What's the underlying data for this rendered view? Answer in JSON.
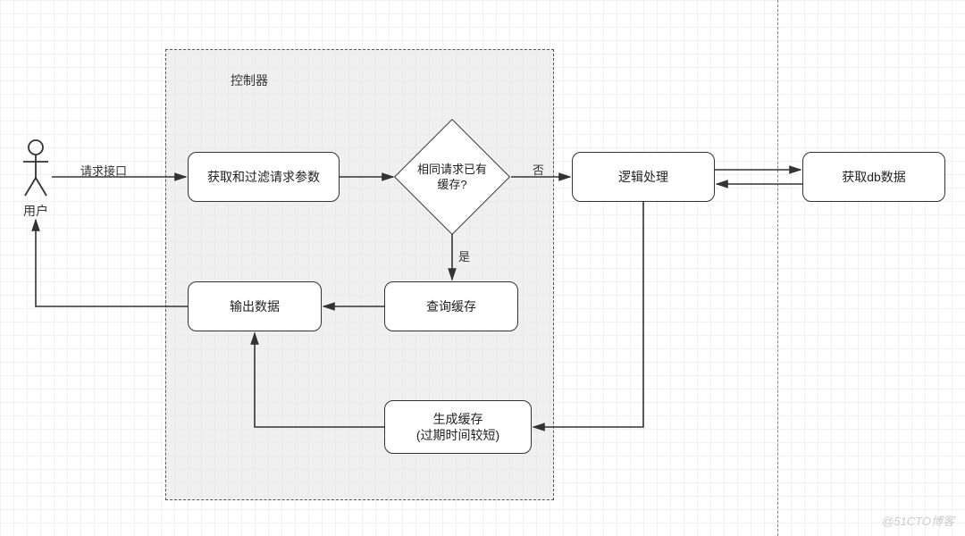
{
  "diagram": {
    "actor_label": "用户",
    "controller_title": "控制器",
    "nodes": {
      "filter_params": "获取和过滤请求参数",
      "decision": "相同请求已有\n缓存?",
      "logic": "逻辑处理",
      "fetch_db": "获取db数据",
      "query_cache": "查询缓存",
      "output": "输出数据",
      "gen_cache_line1": "生成缓存",
      "gen_cache_line2": "(过期时间较短)"
    },
    "edges": {
      "request_api": "请求接口",
      "yes": "是",
      "no": "否"
    },
    "watermark": "@51CTO博客"
  }
}
